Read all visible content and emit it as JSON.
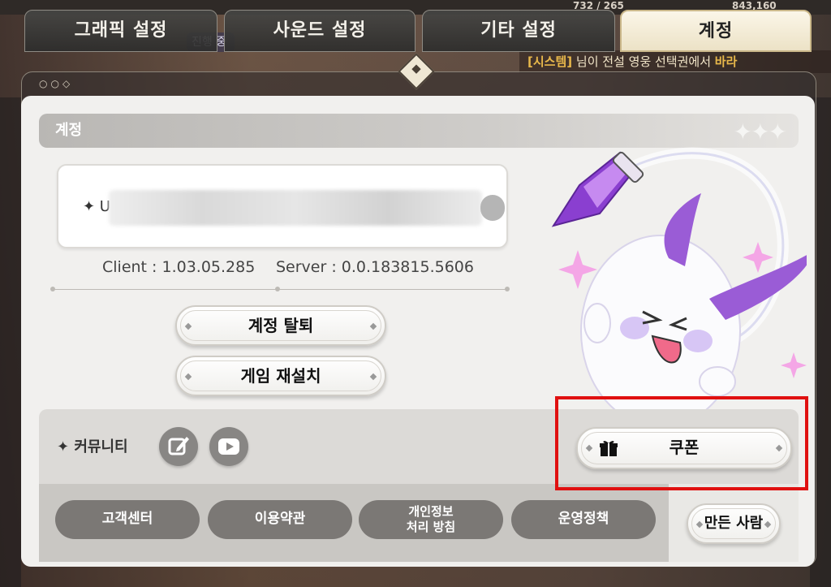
{
  "tabs": [
    {
      "label": "그래픽 설정",
      "active": false
    },
    {
      "label": "사운드 설정",
      "active": false
    },
    {
      "label": "기타 설정",
      "active": false
    },
    {
      "label": "계정",
      "active": true
    }
  ],
  "background": {
    "progress_chip": "진행 중",
    "counter_left": "732 / 265",
    "counter_right": "843,160",
    "banner_prefix": "[시스템]",
    "banner_text": "님이 전설 영웅 선택권에서",
    "banner_tail": "바라"
  },
  "panel": {
    "section_title": "계정",
    "uid_prefix": "✦ U",
    "client_version": "Client : 1.03.05.285",
    "server_version": "Server : 0.0.183815.5606",
    "delete_account_label": "계정 탈퇴",
    "reinstall_label": "게임 재설치",
    "community_label": "✦ 커뮤니티",
    "community_icons": [
      "forum-edit-icon",
      "youtube-icon"
    ],
    "coupon_label": "쿠폰",
    "coupon_icon": "gift-icon",
    "links": [
      "고객센터",
      "이용약관",
      "개인정보\n처리 방침",
      "운영정책"
    ],
    "credits_label": "만든 사람"
  },
  "colors": {
    "tab_active_bg": "#fbf6e8",
    "panel_bg": "#f1f0ee",
    "pill_bg": "#7b7875",
    "highlight": "#e01010",
    "mascot_purple": "#9a5cd6"
  }
}
